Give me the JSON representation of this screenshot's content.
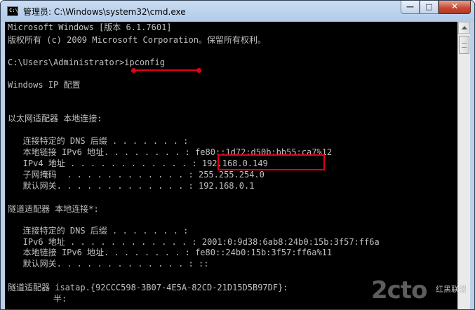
{
  "window": {
    "title": "管理员: C:\\Windows\\system32\\cmd.exe",
    "icon_text": "C:\\",
    "buttons": {
      "minimize": "—",
      "maximize": "□",
      "close": "✕"
    }
  },
  "console": {
    "lines": [
      "Microsoft Windows [版本 6.1.7601]",
      "版权所有 (c) 2009 Microsoft Corporation。保留所有权利。",
      "",
      "C:\\Users\\Administrator>ipconfig",
      "",
      "Windows IP 配置",
      "",
      "",
      "以太网适配器 本地连接:",
      "",
      "   连接特定的 DNS 后缀 . . . . . . . :",
      "   本地链接 IPv6 地址. . . . . . . . : fe80::1d72:d50b:bb55:ca7%12",
      "   IPv4 地址 . . . . . . . . . . . . : 192.168.0.149",
      "   子网掩码  . . . . . . . . . . . . : 255.255.254.0",
      "   默认网关. . . . . . . . . . . . . : 192.168.0.1",
      "",
      "隧道适配器 本地连接*:",
      "",
      "   连接特定的 DNS 后缀 . . . . . . . :",
      "   IPv6 地址 . . . . . . . . . . . . : 2001:0:9d38:6ab8:24b0:15b:3f57:ff6a",
      "   本地链接 IPv6 地址. . . . . . . . : fe80::24b0:15b:3f57:ff6a%11",
      "   默认网关. . . . . . . . . . . . . : ::",
      "",
      "隧道适配器 isatap.{92CCC598-3B07-4E5A-82CD-21D15D5B97DF}:",
      "         半:"
    ]
  },
  "watermark": {
    "logo": "2cto",
    "sub": "红黑联盟"
  },
  "colors": {
    "annotation": "#e2001a",
    "console_text": "#c0c0c0",
    "console_bg": "#000000"
  }
}
